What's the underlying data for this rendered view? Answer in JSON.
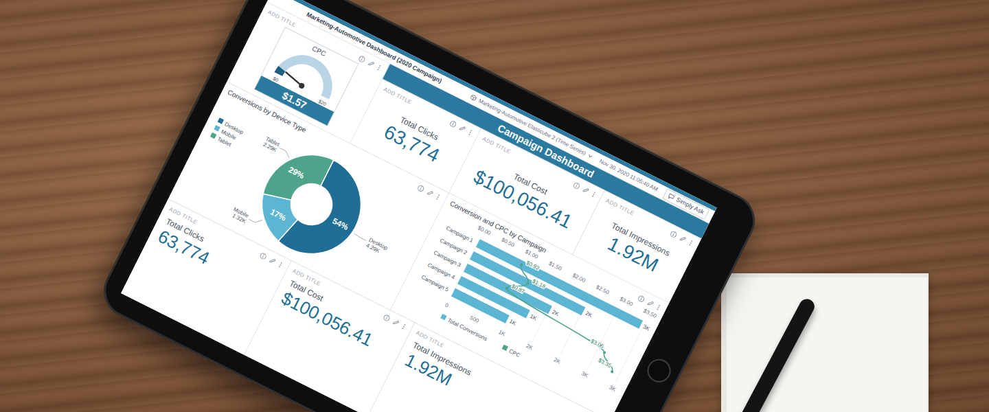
{
  "dashboard": {
    "title": "Marketing-Automotive Dashboard (2020 Campaign)",
    "cube": "Marketing-Automotive Elasticube 2 (Time Series)",
    "timestamp": "Nov 30, 2020 11:05:40 AM",
    "ask_button": "Simply Ask",
    "banner": "Campaign Dashboard"
  },
  "gauge": {
    "header": "ADD TITLE",
    "label": "CPC",
    "min": "$0",
    "max": "$20",
    "value": "$1.57",
    "level": 0.0785
  },
  "kpis": [
    {
      "header": "ADD TITLE",
      "title": "Total Clicks",
      "value": "63,774"
    },
    {
      "header": "ADD TITLE",
      "title": "Total Cost",
      "value": "$100,056.41"
    },
    {
      "header": "ADD TITLE",
      "title": "Total Impressions",
      "value": "1.92M"
    }
  ],
  "donut": {
    "title": "Conversions by Device Type",
    "slices": [
      {
        "name": "Desktop",
        "value": 4290,
        "percent": "54%",
        "label": "4.29K",
        "color": "#1f6e96"
      },
      {
        "name": "Mobile",
        "value": 1320,
        "percent": "17%",
        "label": "1.32K",
        "color": "#5cb5d2"
      },
      {
        "name": "Tablet",
        "value": 2290,
        "percent": "29%",
        "label": "2.29K",
        "color": "#4ea48b"
      }
    ]
  },
  "chart": {
    "title": "Conversion and CPC by Campaign",
    "categories": [
      "Campaign 1",
      "Campaign 2",
      "Campaign 3",
      "Campaign 4",
      "Campaign 5"
    ],
    "cpc_axis": {
      "max": 3.5,
      "ticks": [
        "$0.00",
        "$0.50",
        "$1.00",
        "$1.50",
        "$2.00",
        "$2.50",
        "$3.00",
        "$3.50"
      ]
    },
    "conversion_axis": {
      "max": 3000,
      "ticks": [
        "0",
        "500",
        "1K",
        "2K",
        "2K",
        "3K",
        "3K"
      ]
    },
    "series": [
      {
        "name": "Total Conversions",
        "values": [
          2950,
          2020,
          1530,
          1240,
          980
        ],
        "labels": [
          "3K",
          "2K",
          "2K",
          "1K",
          "1K"
        ],
        "color": "#5cb5d2"
      },
      {
        "name": "CPC",
        "values": [
          0.92,
          1.18,
          0.87,
          3.06,
          3.35
        ],
        "labels": [
          "$0.92",
          "$1.18",
          "$0.87",
          "$3.06",
          "$3.35"
        ],
        "color": "#4ea48b"
      }
    ]
  },
  "bottom_cards": [
    {
      "header": "ADD TITLE",
      "title": "Total Clicks",
      "value": "63,774"
    },
    {
      "header": "ADD TITLE",
      "title": "Total Cost",
      "value": "$100,056.41"
    },
    {
      "header": "ADD TITLE",
      "title": "Total Impressions",
      "value": "1.92M"
    }
  ]
}
